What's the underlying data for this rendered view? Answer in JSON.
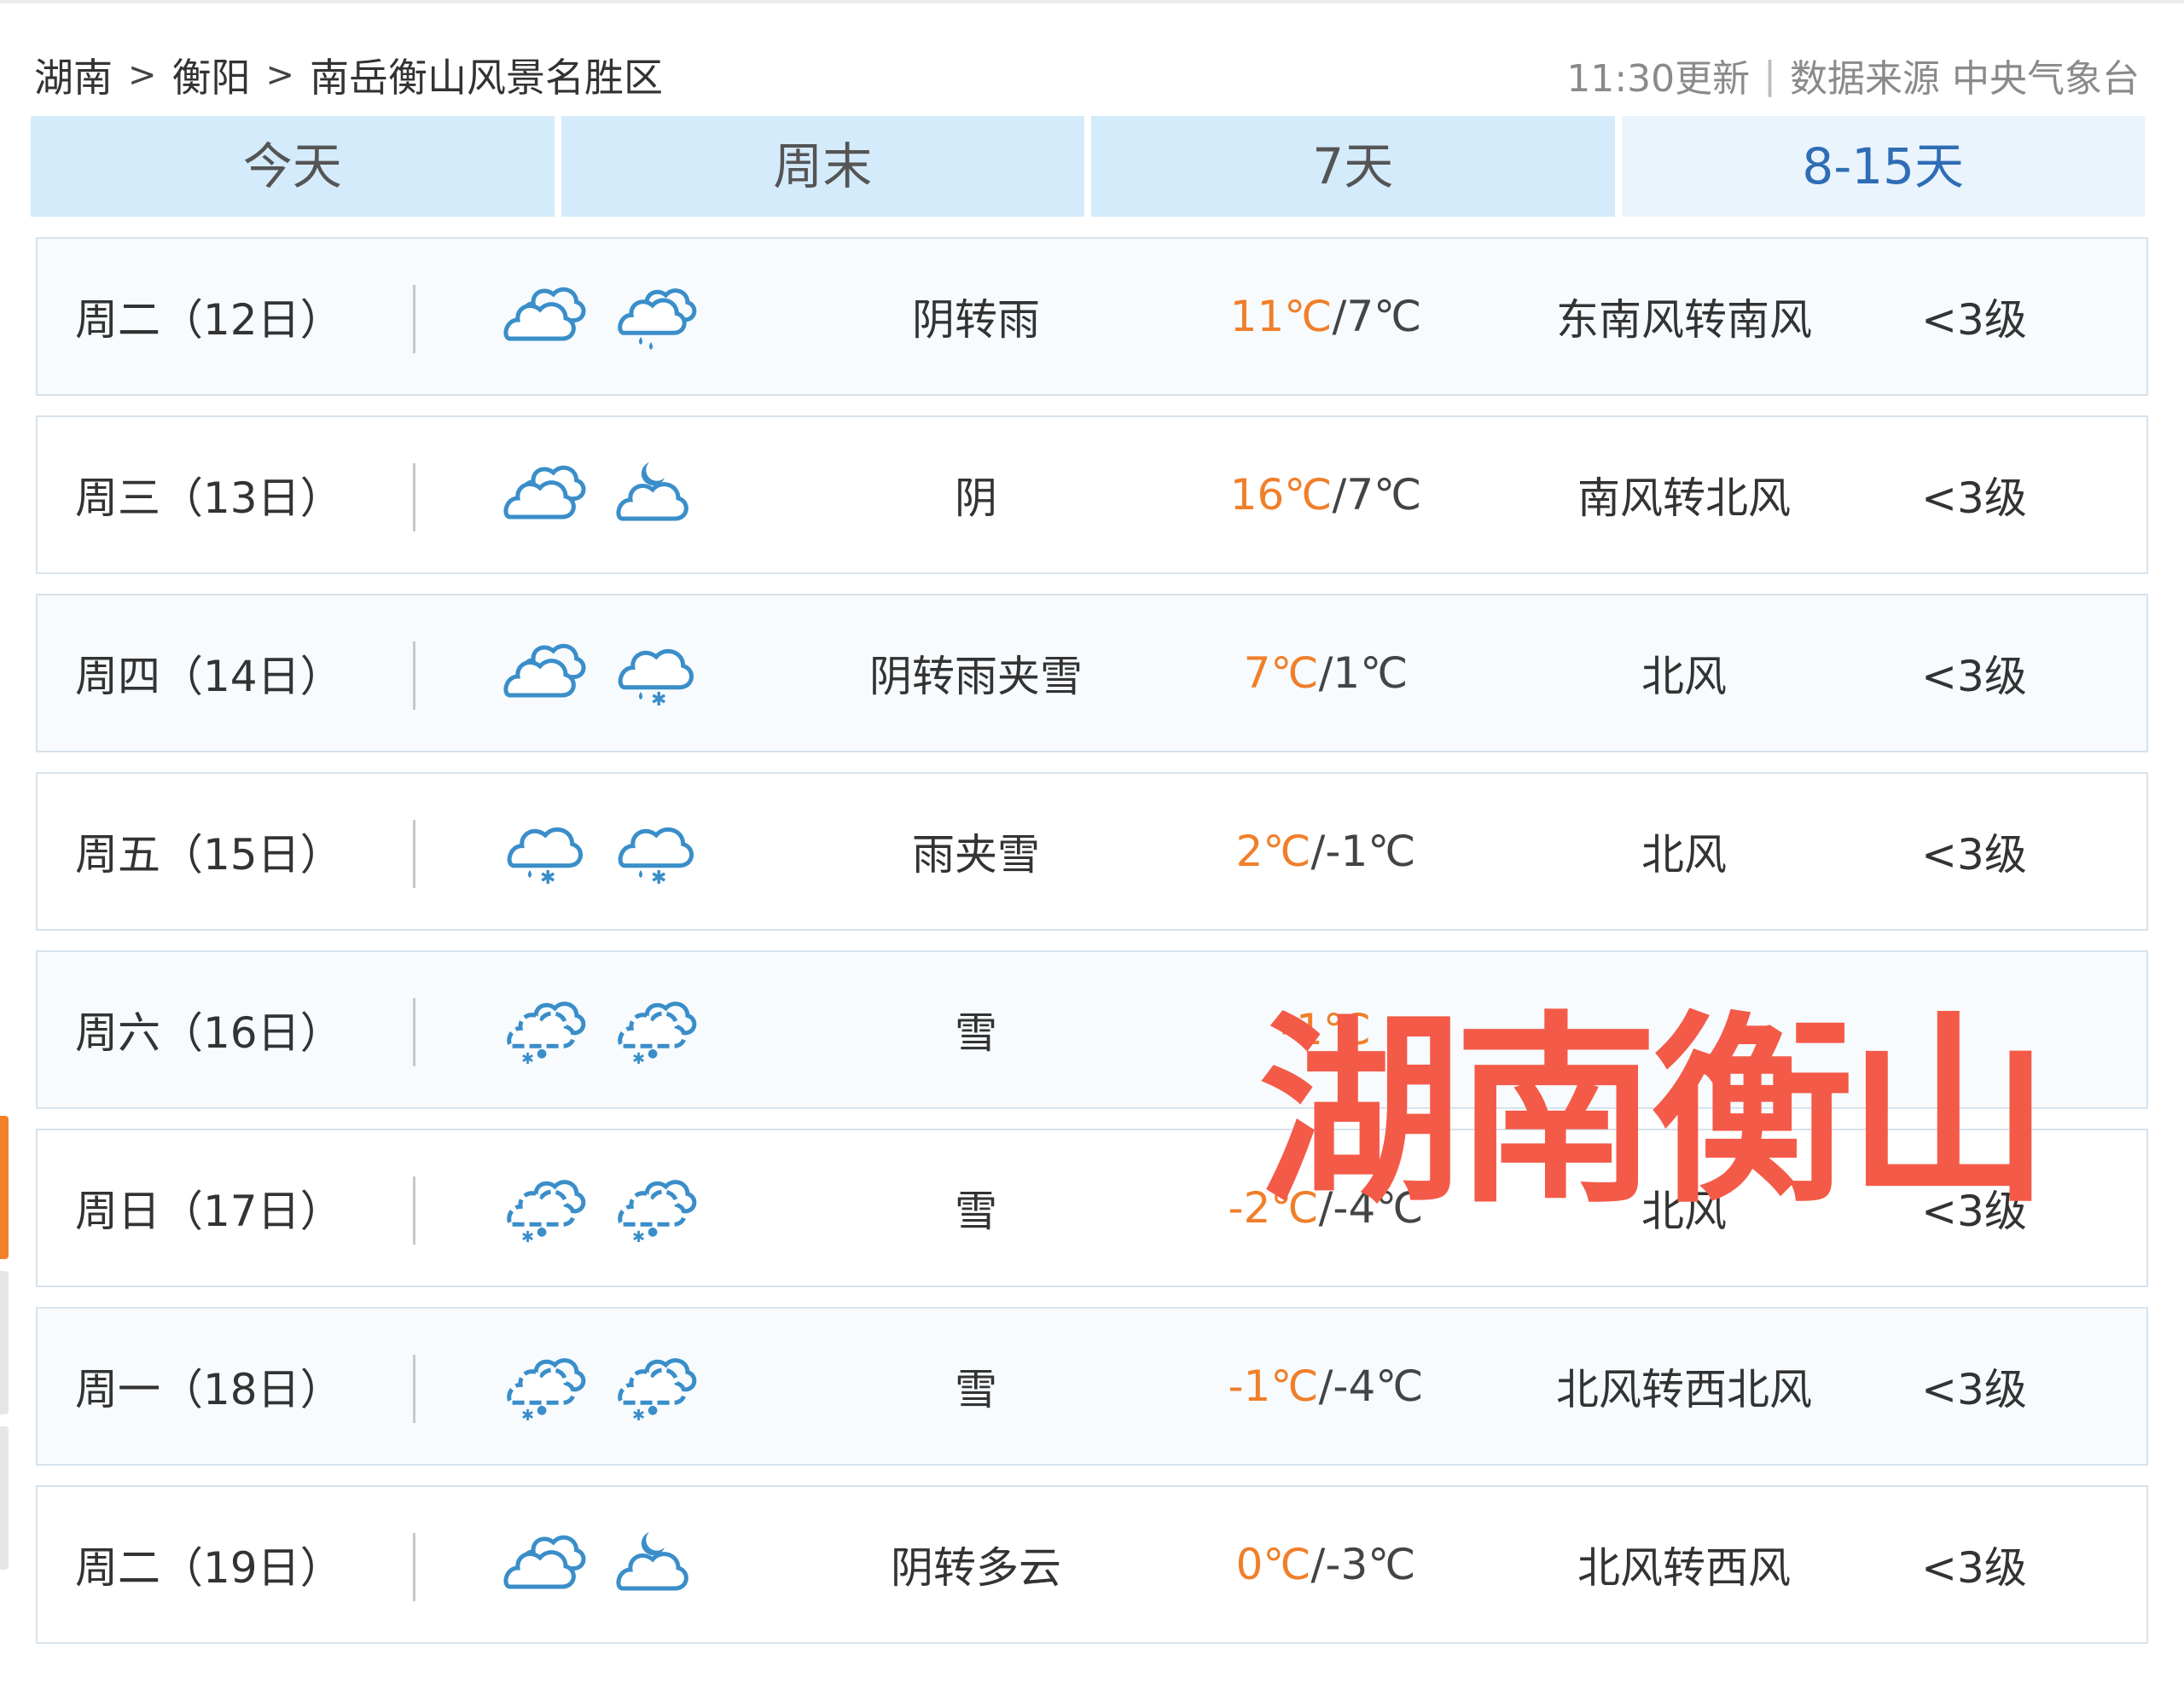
{
  "breadcrumb": {
    "province": "湖南",
    "city": "衡阳",
    "area": "南岳衡山风景名胜区",
    "separator": ">"
  },
  "meta": {
    "update_time": "11:30更新",
    "divider": "|",
    "source": "数据来源 中央气象台"
  },
  "tabs": [
    {
      "label": "今天"
    },
    {
      "label": "周末"
    },
    {
      "label": "7天"
    },
    {
      "label": "8-15天",
      "active": true
    }
  ],
  "forecast": [
    {
      "date": "周二（12日）",
      "icon_day": "cloudy-icon",
      "icon_night": "rain-icon",
      "desc": "阴转雨",
      "high": "11℃",
      "low": "7℃",
      "wind": "东南风转南风",
      "level": "<3级"
    },
    {
      "date": "周三（13日）",
      "icon_day": "cloudy-icon",
      "icon_night": "partly-cloudy-night-icon",
      "desc": "阴",
      "high": "16℃",
      "low": "7℃",
      "wind": "南风转北风",
      "level": "<3级"
    },
    {
      "date": "周四（14日）",
      "icon_day": "cloudy-icon",
      "icon_night": "sleet-icon",
      "desc": "阴转雨夹雪",
      "high": "7℃",
      "low": "1℃",
      "wind": "北风",
      "level": "<3级"
    },
    {
      "date": "周五（15日）",
      "icon_day": "sleet-icon",
      "icon_night": "sleet-icon",
      "desc": "雨夹雪",
      "high": "2℃",
      "low": "-1℃",
      "wind": "北风",
      "level": "<3级"
    },
    {
      "date": "周六（16日）",
      "icon_day": "snow-icon",
      "icon_night": "snow-icon",
      "desc": "雪",
      "high": "-1℃",
      "low": "",
      "wind": "",
      "level": ""
    },
    {
      "date": "周日（17日）",
      "icon_day": "snow-icon",
      "icon_night": "snow-icon",
      "desc": "雪",
      "high": "-2℃",
      "low": "-4℃",
      "wind": "北风",
      "level": "<3级"
    },
    {
      "date": "周一（18日）",
      "icon_day": "snow-icon",
      "icon_night": "snow-icon",
      "desc": "雪",
      "high": "-1℃",
      "low": "-4℃",
      "wind": "北风转西北风",
      "level": "<3级"
    },
    {
      "date": "周二（19日）",
      "icon_day": "cloudy-icon",
      "icon_night": "partly-cloudy-night-icon",
      "desc": "阴转多云",
      "high": "0℃",
      "low": "-3℃",
      "wind": "北风转西风",
      "level": "<3级"
    }
  ],
  "overlay_text": "湖南衡山",
  "colors": {
    "tab_bg": "#d4ebfb",
    "tab_active_text": "#2f6db5",
    "high_temp": "#f07f2a",
    "icon_stroke": "#3a8ec9",
    "overlay": "#f45a48"
  }
}
